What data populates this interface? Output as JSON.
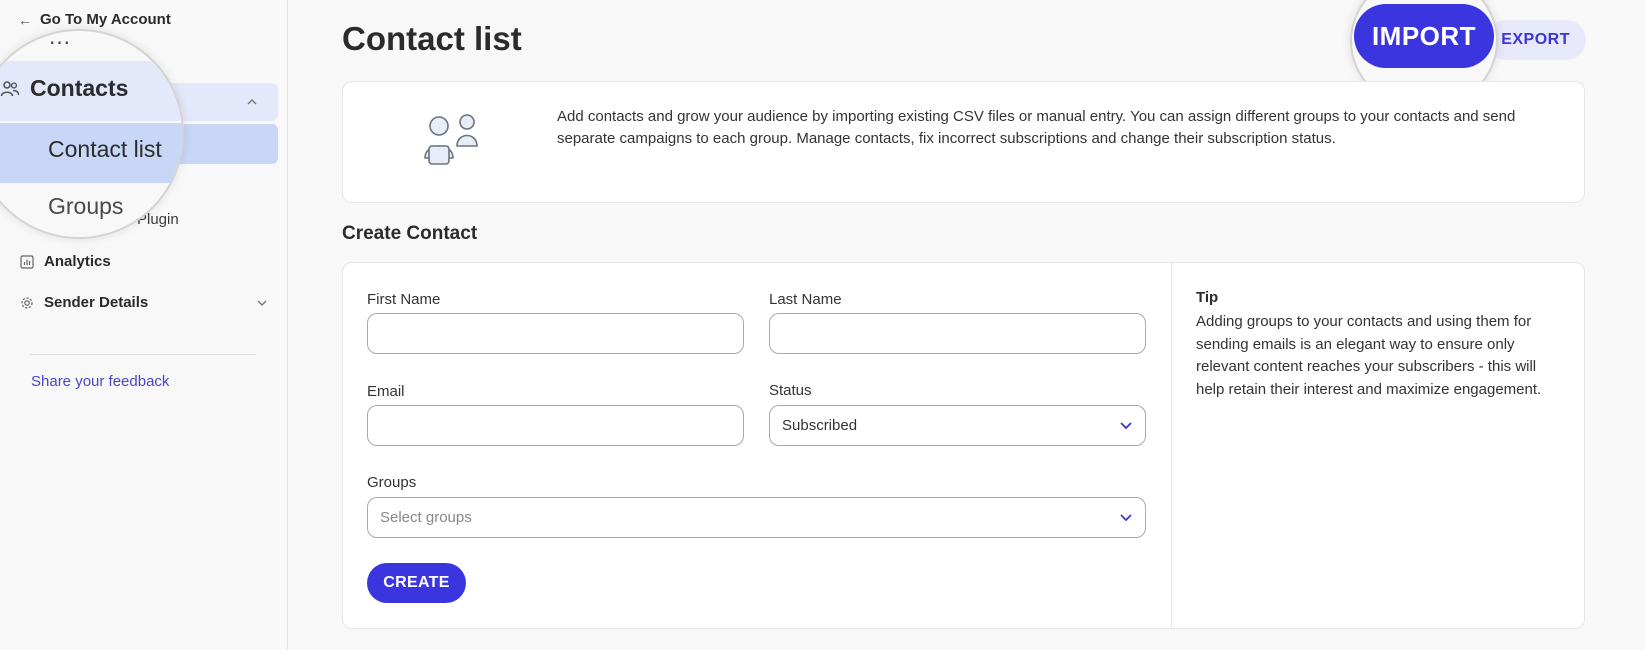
{
  "sidebar": {
    "back_link": "Go To My Account",
    "nav": {
      "contacts": "Contacts",
      "contact_list": "Contact list",
      "groups": "Groups",
      "plugin_partial": "Plugin",
      "analytics": "Analytics",
      "sender_details": "Sender Details"
    },
    "feedback": "Share your feedback"
  },
  "header": {
    "title": "Contact list",
    "import_label": "IMPORT",
    "export_label": "EXPORT"
  },
  "info": {
    "text": "Add contacts and grow your audience by importing existing CSV files or manual entry. You can assign different groups to your contacts and send separate campaigns to each group. Manage contacts, fix incorrect subscriptions and change their subscription status."
  },
  "create_section": {
    "title": "Create Contact",
    "first_name_label": "First Name",
    "first_name_value": "",
    "last_name_label": "Last Name",
    "last_name_value": "",
    "email_label": "Email",
    "email_value": "",
    "status_label": "Status",
    "status_value": "Subscribed",
    "groups_label": "Groups",
    "groups_placeholder": "Select groups",
    "create_label": "CREATE"
  },
  "tip": {
    "title": "Tip",
    "body": "Adding groups to your contacts and using them for sending emails is an elegant way to ensure only relevant content reaches your subscribers - this will help retain their interest and maximize engagement."
  },
  "colors": {
    "accent": "#3b35e0",
    "link": "#4a45c8",
    "selected_nav": "#c9d7f7",
    "hover_nav": "#e4e8fb"
  }
}
